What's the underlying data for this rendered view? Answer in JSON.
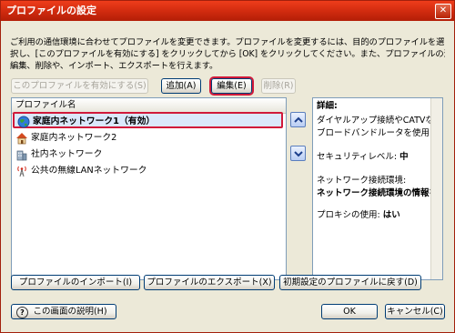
{
  "window": {
    "title": "プロファイルの設定",
    "close_symbol": "✕"
  },
  "description_lines": [
    "ご利用の通信環境に合わせてプロファイルを変更できます。プロファイルを変更するには、目的のプロファイルを選",
    "択し、[このプロファイルを有効にする] をクリックしてから [OK] をクリックしてください。また、プロファイルの追加、",
    "編集、削除や、インポート、エクスポートを行えます。"
  ],
  "toolbar": {
    "enable": "このプロファイルを有効にする(S)",
    "add": "追加(A)",
    "edit": "編集(E)",
    "delete": "削除(R)"
  },
  "profile_list": {
    "header": "プロファイル名",
    "items": [
      {
        "label": "家庭内ネットワーク1（有効）",
        "icon": "globe-icon"
      },
      {
        "label": "家庭内ネットワーク2",
        "icon": "house-icon"
      },
      {
        "label": "社内ネットワーク",
        "icon": "office-building-icon"
      },
      {
        "label": "公共の無線LANネットワーク",
        "icon": "wireless-tower-icon"
      }
    ]
  },
  "details": {
    "heading": "詳細:",
    "desc1": "ダイヤルアップ接続やCATVなど",
    "desc2": "ブロードバンドルータを使用しな",
    "security_label": "セキュリティレベル:",
    "security_value": "中",
    "network_label": "ネットワーク接続環境:",
    "network_value": "ネットワーク接続環境の情報を",
    "proxy_label": "プロキシの使用:",
    "proxy_value": "はい"
  },
  "bottom_buttons": {
    "import": "プロファイルのインポート(I)",
    "export": "プロファイルのエクスポート(X)",
    "restore": "初期設定のプロファイルに戻す(D)"
  },
  "footer": {
    "help": "この画面の説明(H)",
    "ok": "OK",
    "cancel": "キャンセル(C)"
  },
  "colors": {
    "titlebar": "#cf2a0e",
    "highlight": "#d1193a",
    "selected_row": "#dbe8fb"
  }
}
